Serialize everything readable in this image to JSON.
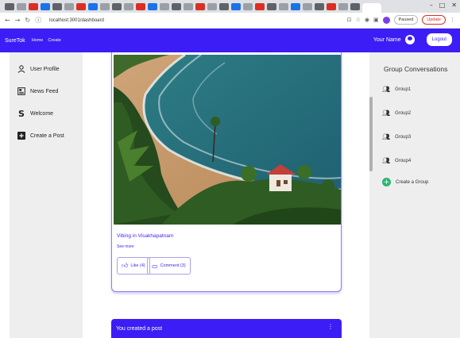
{
  "browser": {
    "url": "localhost:3001/dashboard",
    "pill_paused": "Paused",
    "pill_update": "Update"
  },
  "header": {
    "brand": "SureTok",
    "nav": [
      "Home",
      "Create"
    ],
    "user_name": "Your Name",
    "logout_label": "Logout",
    "accent_color": "#3d1df5"
  },
  "sidebar": {
    "items": [
      {
        "label": "User Profile",
        "icon": "person-icon"
      },
      {
        "label": "News Feed",
        "icon": "newspaper-icon"
      },
      {
        "label": "Welcome",
        "icon": "s-logo-icon"
      },
      {
        "label": "Create a Post",
        "icon": "add-box-icon"
      }
    ]
  },
  "post": {
    "caption": "Vibing in Visakhapatnam",
    "see_more": "See more",
    "like_label": "Like (4)",
    "comment_label": "Comment (3)"
  },
  "second_post": {
    "title": "You created a post"
  },
  "right_sidebar": {
    "title": "Group Conversations",
    "groups": [
      "Group1",
      "Group2",
      "Group3",
      "Group4"
    ],
    "create_label": "Create a Group",
    "create_color": "#2bb673"
  }
}
